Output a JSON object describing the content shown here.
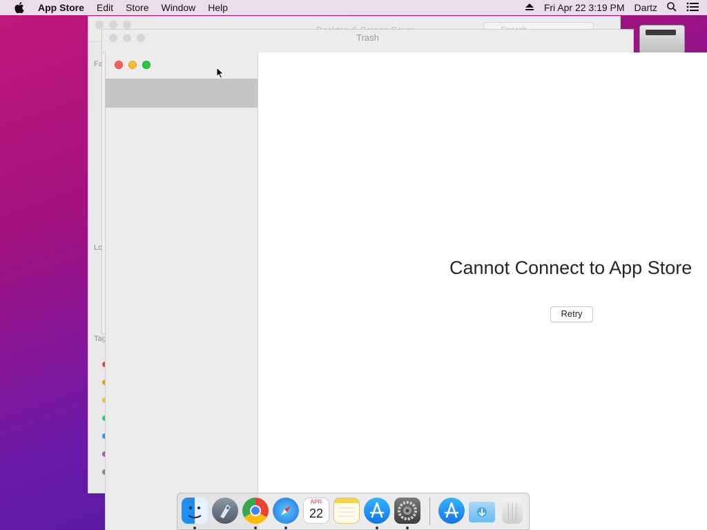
{
  "menubar": {
    "app_name": "App Store",
    "items": [
      "Edit",
      "Store",
      "Window",
      "Help"
    ],
    "clock": "Fri Apr 22  3:19 PM",
    "user": "Dartz"
  },
  "back_window_1": {
    "title": "Desktop & Screen Saver",
    "search_placeholder": "Search",
    "sidebar_labels": [
      "Fa",
      "Lo",
      "Tag"
    ]
  },
  "back_window_2": {
    "title": "Trash"
  },
  "main_window": {
    "error_title": "Cannot Connect to App Store",
    "retry_label": "Retry"
  },
  "dock": {
    "apps": [
      "Finder",
      "Launchpad",
      "Chrome",
      "Safari",
      "Calendar",
      "Notes",
      "App Store",
      "System Preferences",
      "Downloads",
      "Trash"
    ],
    "calendar_month": "APR",
    "calendar_day": "22"
  },
  "colors": {
    "close": "#fe5f57",
    "minimize": "#febc2e",
    "zoom": "#28c840"
  }
}
